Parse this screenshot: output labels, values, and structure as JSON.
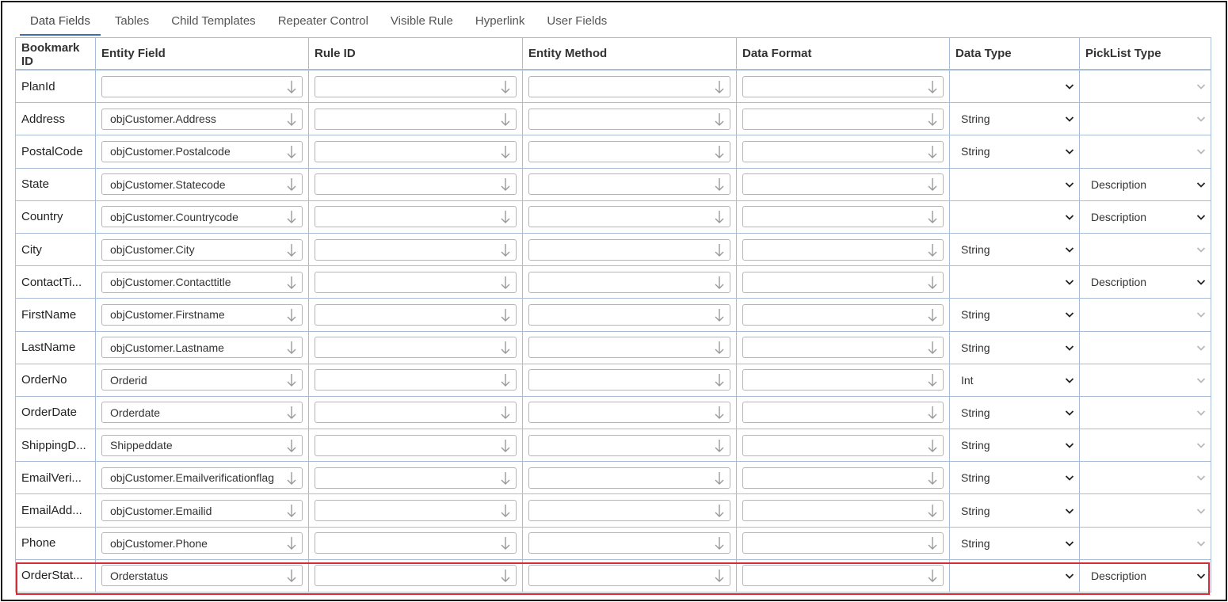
{
  "tabs": [
    "Data Fields",
    "Tables",
    "Child Templates",
    "Repeater Control",
    "Visible Rule",
    "Hyperlink",
    "User Fields"
  ],
  "columns": [
    "Bookmark ID",
    "Entity Field",
    "Rule ID",
    "Entity Method",
    "Data Format",
    "Data Type",
    "PickList Type"
  ],
  "rows": [
    {
      "bookmark": "PlanId",
      "entity": "",
      "datatype": "",
      "picklist": ""
    },
    {
      "bookmark": "Address",
      "entity": "objCustomer.Address",
      "datatype": "String",
      "picklist": ""
    },
    {
      "bookmark": "PostalCode",
      "entity": "objCustomer.Postalcode",
      "datatype": "String",
      "picklist": ""
    },
    {
      "bookmark": "State",
      "entity": "objCustomer.Statecode",
      "datatype": "",
      "picklist": "Description"
    },
    {
      "bookmark": "Country",
      "entity": "objCustomer.Countrycode",
      "datatype": "",
      "picklist": "Description"
    },
    {
      "bookmark": "City",
      "entity": "objCustomer.City",
      "datatype": "String",
      "picklist": ""
    },
    {
      "bookmark": "ContactTi...",
      "entity": "objCustomer.Contacttitle",
      "datatype": "",
      "picklist": "Description"
    },
    {
      "bookmark": "FirstName",
      "entity": "objCustomer.Firstname",
      "datatype": "String",
      "picklist": ""
    },
    {
      "bookmark": "LastName",
      "entity": "objCustomer.Lastname",
      "datatype": "String",
      "picklist": ""
    },
    {
      "bookmark": "OrderNo",
      "entity": "Orderid",
      "datatype": "Int",
      "picklist": ""
    },
    {
      "bookmark": "OrderDate",
      "entity": "Orderdate",
      "datatype": "String",
      "picklist": ""
    },
    {
      "bookmark": "ShippingD...",
      "entity": "Shippeddate",
      "datatype": "String",
      "picklist": ""
    },
    {
      "bookmark": "EmailVeri...",
      "entity": "objCustomer.Emailverificationflag",
      "datatype": "String",
      "picklist": ""
    },
    {
      "bookmark": "EmailAdd...",
      "entity": "objCustomer.Emailid",
      "datatype": "String",
      "picklist": ""
    },
    {
      "bookmark": "Phone",
      "entity": "objCustomer.Phone",
      "datatype": "String",
      "picklist": ""
    },
    {
      "bookmark": "OrderStat...",
      "entity": "Orderstatus",
      "datatype": "",
      "picklist": "Description"
    }
  ],
  "colors": {
    "grid_border": "#a9bed6",
    "active_tab": "#3d6fb0",
    "highlight": "#d62c3a"
  },
  "icons": {
    "combo": "arrow-down-icon",
    "select": "chevron-down-icon"
  }
}
